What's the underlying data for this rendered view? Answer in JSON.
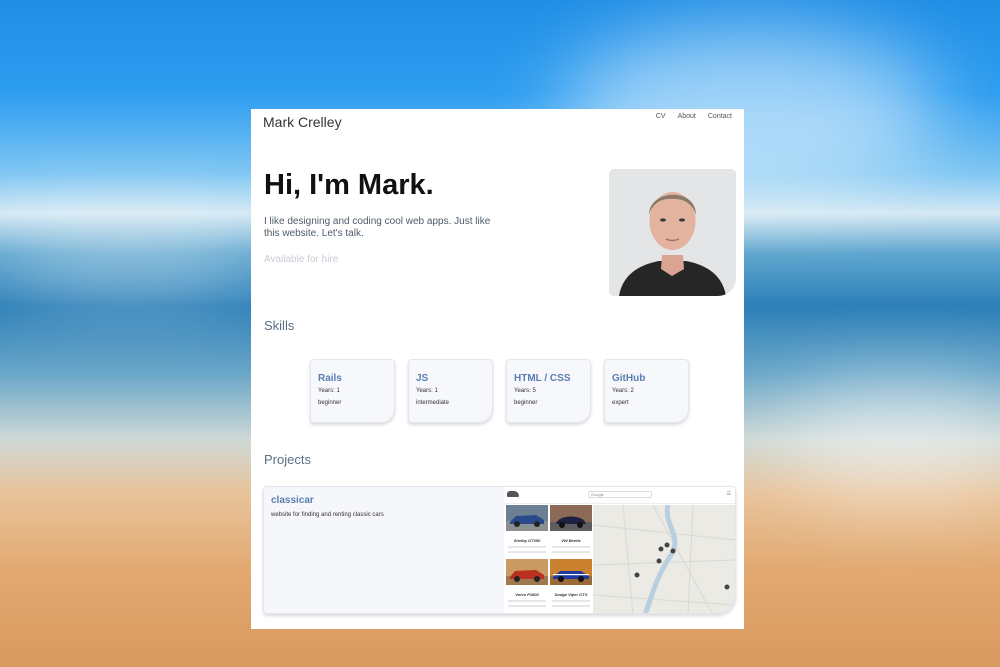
{
  "site": {
    "brand": "Mark Crelley",
    "nav": [
      "CV",
      "About",
      "Contact"
    ]
  },
  "hero": {
    "title": "Hi, I'm Mark.",
    "text": "I like designing and coding cool web apps. Just like this website. Let's talk.",
    "status": "Available for hire"
  },
  "skills": {
    "heading": "Skills",
    "items": [
      {
        "name": "Rails",
        "years": "Years: 1",
        "level": "beginner"
      },
      {
        "name": "JS",
        "years": "Years: 1",
        "level": "intermediate"
      },
      {
        "name": "HTML / CSS",
        "years": "Years: 5",
        "level": "beginner"
      },
      {
        "name": "GitHub",
        "years": "Years: 2",
        "level": "expert"
      }
    ]
  },
  "projects": {
    "heading": "Projects",
    "items": [
      {
        "name": "classicar",
        "description": "website for finding and renting classic cars",
        "preview": {
          "search_placeholder": "Google",
          "cars": [
            "Shelby GT350",
            "VW Beetle",
            "Volvo P1800",
            "Dodge Viper GTS"
          ]
        }
      }
    ]
  },
  "colors": {
    "accent": "#5a7eb0",
    "section_heading": "#5d6f86",
    "muted": "#c7ccd3"
  }
}
